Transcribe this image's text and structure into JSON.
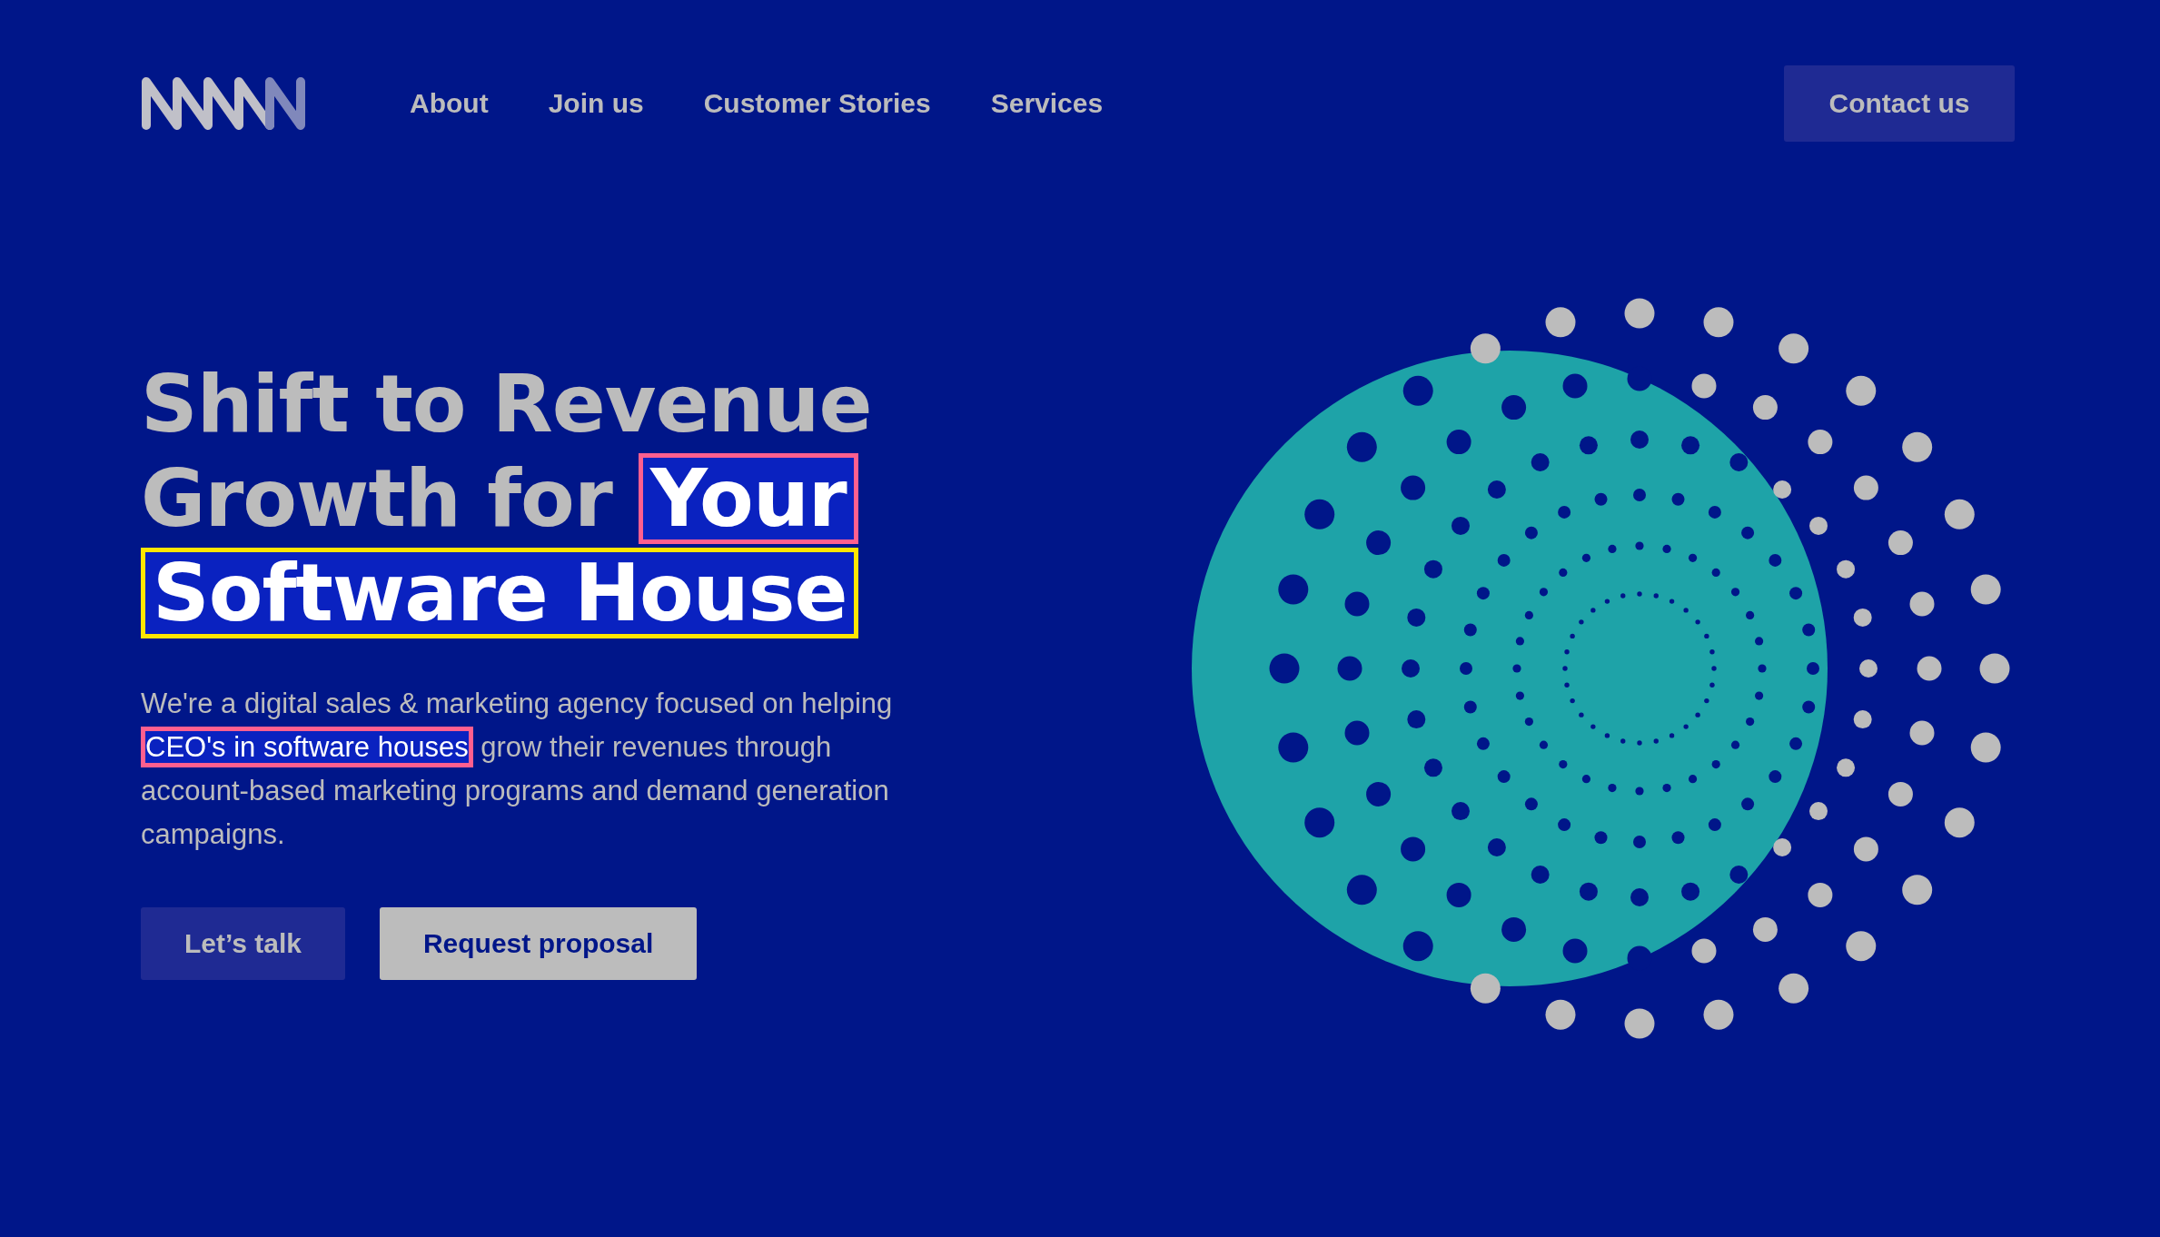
{
  "header": {
    "nav": [
      {
        "label": "About"
      },
      {
        "label": "Join us"
      },
      {
        "label": "Customer Stories"
      },
      {
        "label": "Services"
      }
    ],
    "contact_button": "Contact us"
  },
  "hero": {
    "heading_lines": [
      [
        {
          "text": "Shift to Revenue"
        }
      ],
      [
        {
          "text": "Growth for "
        },
        {
          "text": "Your",
          "color": "#ff5f8f"
        }
      ],
      [
        {
          "text": "Software House",
          "color": "#ffe600"
        }
      ]
    ],
    "paragraph": [
      {
        "text": "We're a digital sales & marketing agency focused on helping "
      },
      {
        "text": "CEO's in software houses",
        "color": "#ff5f8f"
      },
      {
        "text": " grow their revenues through account-based marketing programs and demand generation campaigns."
      }
    ],
    "buttons": [
      {
        "label": "Let’s talk",
        "kind": "secondary"
      },
      {
        "label": "Request proposal",
        "kind": "primary"
      }
    ]
  }
}
